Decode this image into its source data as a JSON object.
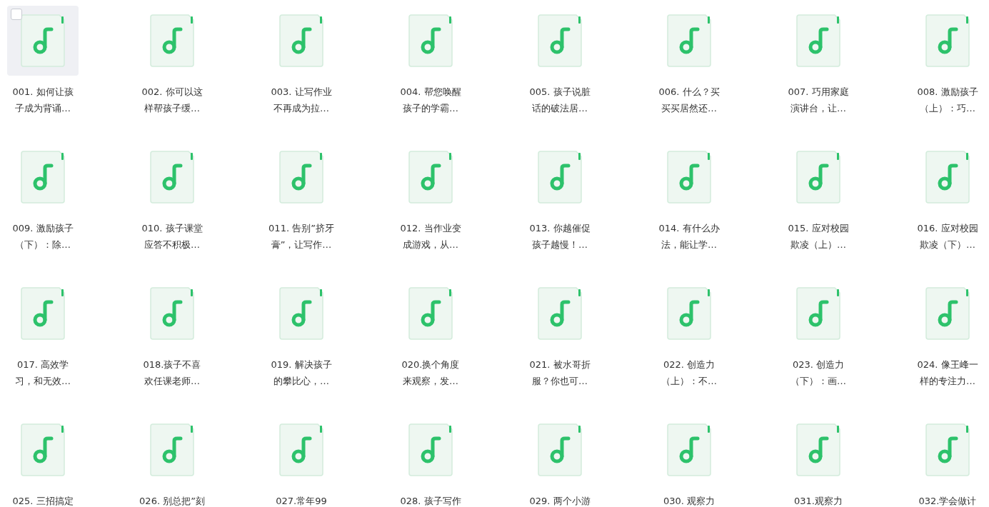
{
  "files": [
    {
      "title_lines": [
        "001. 如何让孩",
        "子成为背诵…"
      ],
      "hovered": true
    },
    {
      "title_lines": [
        "002. 你可以这",
        "样帮孩子缓…"
      ],
      "hovered": false
    },
    {
      "title_lines": [
        "003. 让写作业",
        "不再成为拉…"
      ],
      "hovered": false
    },
    {
      "title_lines": [
        "004. 帮您唤醒",
        "孩子的学霸…"
      ],
      "hovered": false
    },
    {
      "title_lines": [
        "005. 孩子说脏",
        "话的破法居…"
      ],
      "hovered": false
    },
    {
      "title_lines": [
        "006. 什么？买",
        "买买居然还…"
      ],
      "hovered": false
    },
    {
      "title_lines": [
        "007. 巧用家庭",
        "演讲台，让…"
      ],
      "hovered": false
    },
    {
      "title_lines": [
        "008. 激励孩子",
        "（上）：巧…"
      ],
      "hovered": false
    },
    {
      "title_lines": [
        "009. 激励孩子",
        "（下）：除…"
      ],
      "hovered": false
    },
    {
      "title_lines": [
        "010. 孩子课堂",
        "应答不积极…"
      ],
      "hovered": false
    },
    {
      "title_lines": [
        "011. 告别”挤牙",
        "膏”，让写作…"
      ],
      "hovered": false
    },
    {
      "title_lines": [
        "012. 当作业变",
        "成游戏，从…"
      ],
      "hovered": false
    },
    {
      "title_lines": [
        "013. 你越催促",
        "孩子越慢！…"
      ],
      "hovered": false
    },
    {
      "title_lines": [
        "014. 有什么办",
        "法，能让学…"
      ],
      "hovered": false
    },
    {
      "title_lines": [
        "015. 应对校园",
        "欺凌（上）…"
      ],
      "hovered": false
    },
    {
      "title_lines": [
        "016. 应对校园",
        "欺凌（下）…"
      ],
      "hovered": false
    },
    {
      "title_lines": [
        "017. 高效学",
        "习，和无效…"
      ],
      "hovered": false
    },
    {
      "title_lines": [
        "018.孩子不喜",
        "欢任课老师…"
      ],
      "hovered": false
    },
    {
      "title_lines": [
        "019. 解决孩子",
        "的攀比心，…"
      ],
      "hovered": false
    },
    {
      "title_lines": [
        "020.换个角度",
        "来观察，发…"
      ],
      "hovered": false
    },
    {
      "title_lines": [
        "021. 被水哥折",
        "服？你也可…"
      ],
      "hovered": false
    },
    {
      "title_lines": [
        "022. 创造力",
        "（上）：不…"
      ],
      "hovered": false
    },
    {
      "title_lines": [
        "023. 创造力",
        "（下）：画…"
      ],
      "hovered": false
    },
    {
      "title_lines": [
        "024. 像王峰一",
        "样的专注力…"
      ],
      "hovered": false
    },
    {
      "title_lines": [
        "025. 三招搞定"
      ],
      "hovered": false
    },
    {
      "title_lines": [
        "026. 别总把”刻"
      ],
      "hovered": false
    },
    {
      "title_lines": [
        "027.常年99"
      ],
      "hovered": false
    },
    {
      "title_lines": [
        "028. 孩子写作"
      ],
      "hovered": false
    },
    {
      "title_lines": [
        "029. 两个小游"
      ],
      "hovered": false
    },
    {
      "title_lines": [
        "030. 观察力"
      ],
      "hovered": false
    },
    {
      "title_lines": [
        "031.观察力"
      ],
      "hovered": false
    },
    {
      "title_lines": [
        "032.学会做计"
      ],
      "hovered": false
    }
  ]
}
